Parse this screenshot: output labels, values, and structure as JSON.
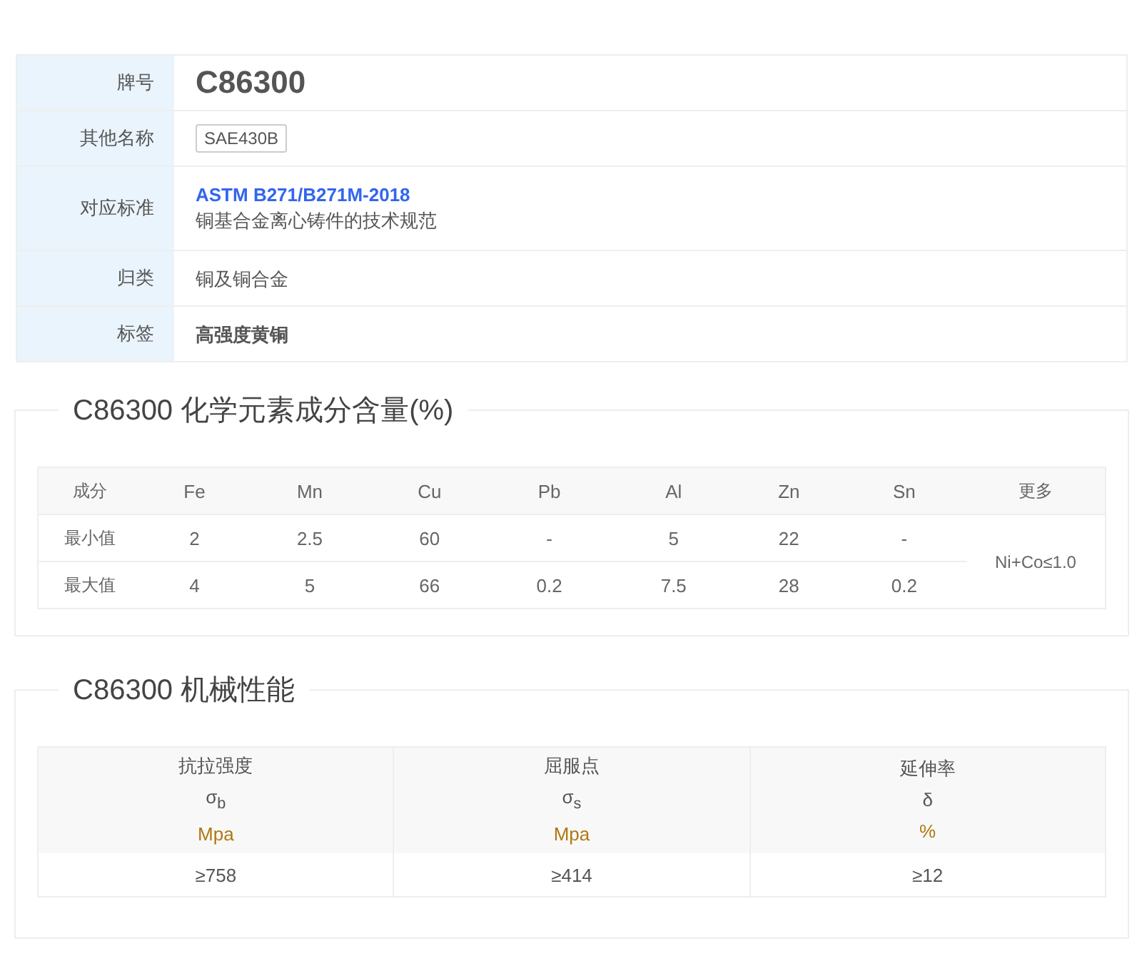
{
  "info": [
    {
      "kind": "title",
      "label": "牌号",
      "value": "C86300"
    },
    {
      "kind": "tag",
      "label": "其他名称",
      "value": "SAE430B"
    },
    {
      "kind": "standard",
      "label": "对应标准",
      "link": "ASTM B271/B271M-2018",
      "value": "铜基合金离心铸件的技术规范"
    },
    {
      "kind": "text",
      "label": "归类",
      "value": "铜及铜合金"
    },
    {
      "kind": "bold",
      "label": "标签",
      "value": "高强度黄铜"
    }
  ],
  "composition": {
    "title": "C86300 化学元素成分含量(%)",
    "header_label": "成分",
    "elements": [
      "Fe",
      "Mn",
      "Cu",
      "Pb",
      "Al",
      "Zn",
      "Sn"
    ],
    "more_label": "更多",
    "rows": [
      {
        "label": "最小值",
        "values": [
          "2",
          "2.5",
          "60",
          "-",
          "5",
          "22",
          "-"
        ]
      },
      {
        "label": "最大值",
        "values": [
          "4",
          "5",
          "66",
          "0.2",
          "7.5",
          "28",
          "0.2"
        ]
      }
    ],
    "more_value": "Ni+Co≤1.0"
  },
  "mechanical": {
    "title": "C86300 机械性能",
    "columns": [
      {
        "name": "抗拉强度",
        "symbol": "σ$_{b}$",
        "unit": "Mpa",
        "value": "≥758"
      },
      {
        "name": "屈服点",
        "symbol": "σ$_{s}$",
        "unit": "Mpa",
        "value": "≥414"
      },
      {
        "name": "延伸率",
        "symbol": "δ",
        "unit": "%",
        "value": "≥12"
      }
    ]
  }
}
